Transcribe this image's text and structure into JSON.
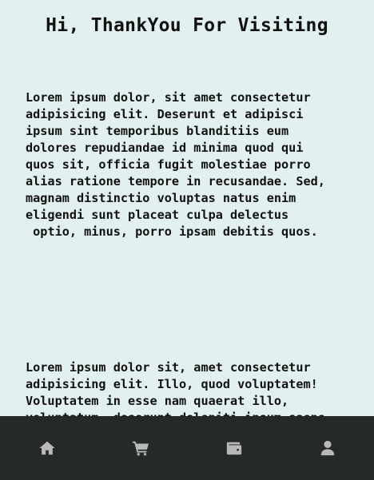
{
  "header": {
    "title": "Hi, ThankYou For Visiting"
  },
  "main": {
    "paragraphs": [
      "Lorem ipsum dolor, sit amet consectetur\nadipisicing elit. Deserunt et adipisci\nipsum sint temporibus blanditiis eum\ndolores repudiandae id minima quod qui\nquos sit, officia fugit molestiae porro\nalias ratione tempore in recusandae. Sed,\nmagnam distinctio voluptas natus enim\neligendi sunt placeat culpa delectus\n optio, minus, porro ipsam debitis quos.",
      "Lorem ipsum dolor sit, amet consectetur\nadipisicing elit. Illo, quod voluptatem!\nVoluptatem in esse nam quaerat illo,\nvoluptatum, deserunt deleniti ipsum saepe"
    ]
  },
  "bottom_nav": {
    "background": "#262a27",
    "icon_color": "#b9b9b9",
    "items": [
      {
        "icon": "home-icon"
      },
      {
        "icon": "cart-icon"
      },
      {
        "icon": "wallet-icon"
      },
      {
        "icon": "user-icon"
      }
    ]
  }
}
